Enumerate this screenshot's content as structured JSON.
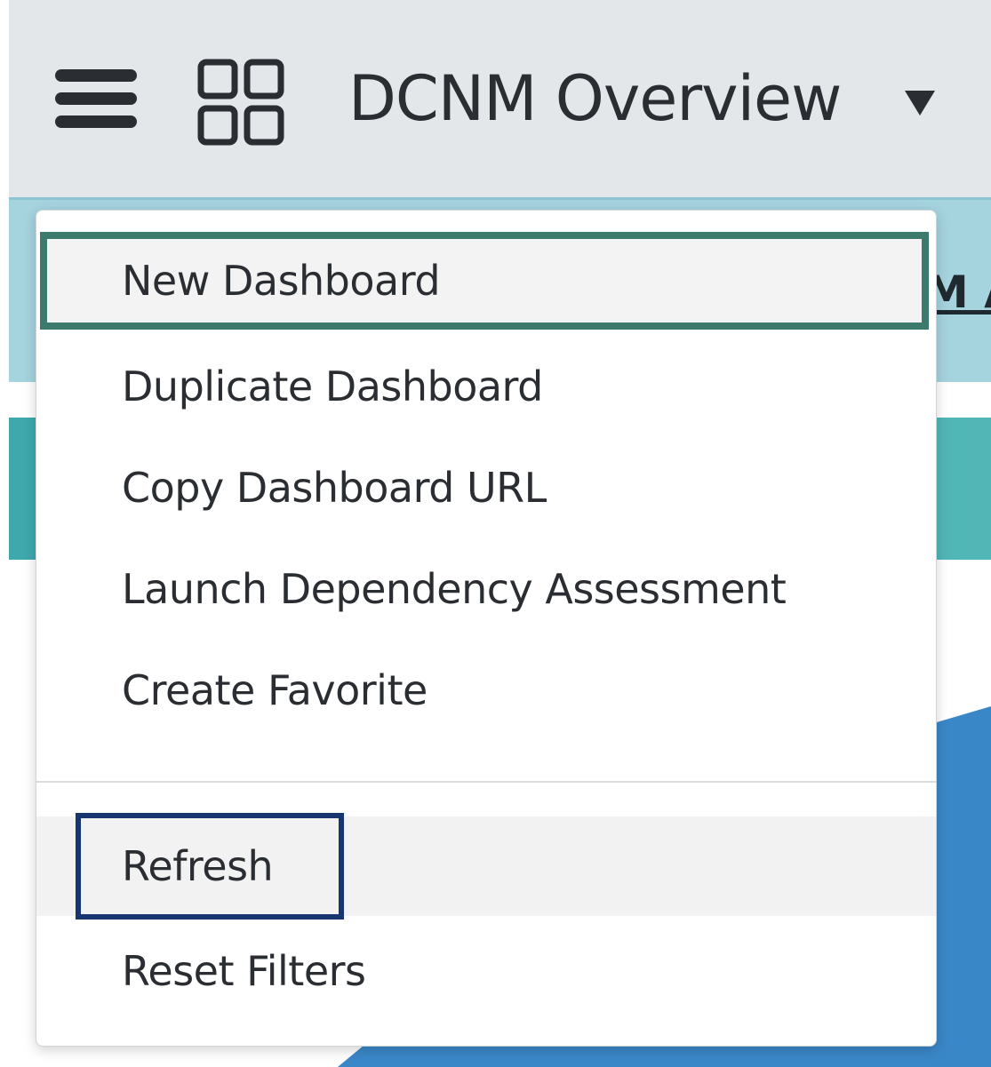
{
  "header": {
    "title": "DCNM Overview"
  },
  "subnav": {
    "partial_link": "M A"
  },
  "menu": {
    "items": [
      {
        "label": "New Dashboard"
      },
      {
        "label": "Duplicate Dashboard"
      },
      {
        "label": "Copy Dashboard URL"
      },
      {
        "label": "Launch Dependency Assessment"
      },
      {
        "label": "Create Favorite"
      }
    ],
    "secondary_items": [
      {
        "label": "Refresh"
      },
      {
        "label": "Reset Filters"
      }
    ]
  },
  "icons": {
    "menu": "hamburger-icon",
    "apps": "grid-icon",
    "dropdown": "caret-down-icon"
  },
  "colors": {
    "header_bg": "#e4e7ea",
    "focus_outline": "#3b7a6c",
    "refresh_outline": "#17356e",
    "subnav_bg": "#a5d3de",
    "teal_band": "#3ea8ad",
    "chart_blue": "#3a87c8"
  }
}
